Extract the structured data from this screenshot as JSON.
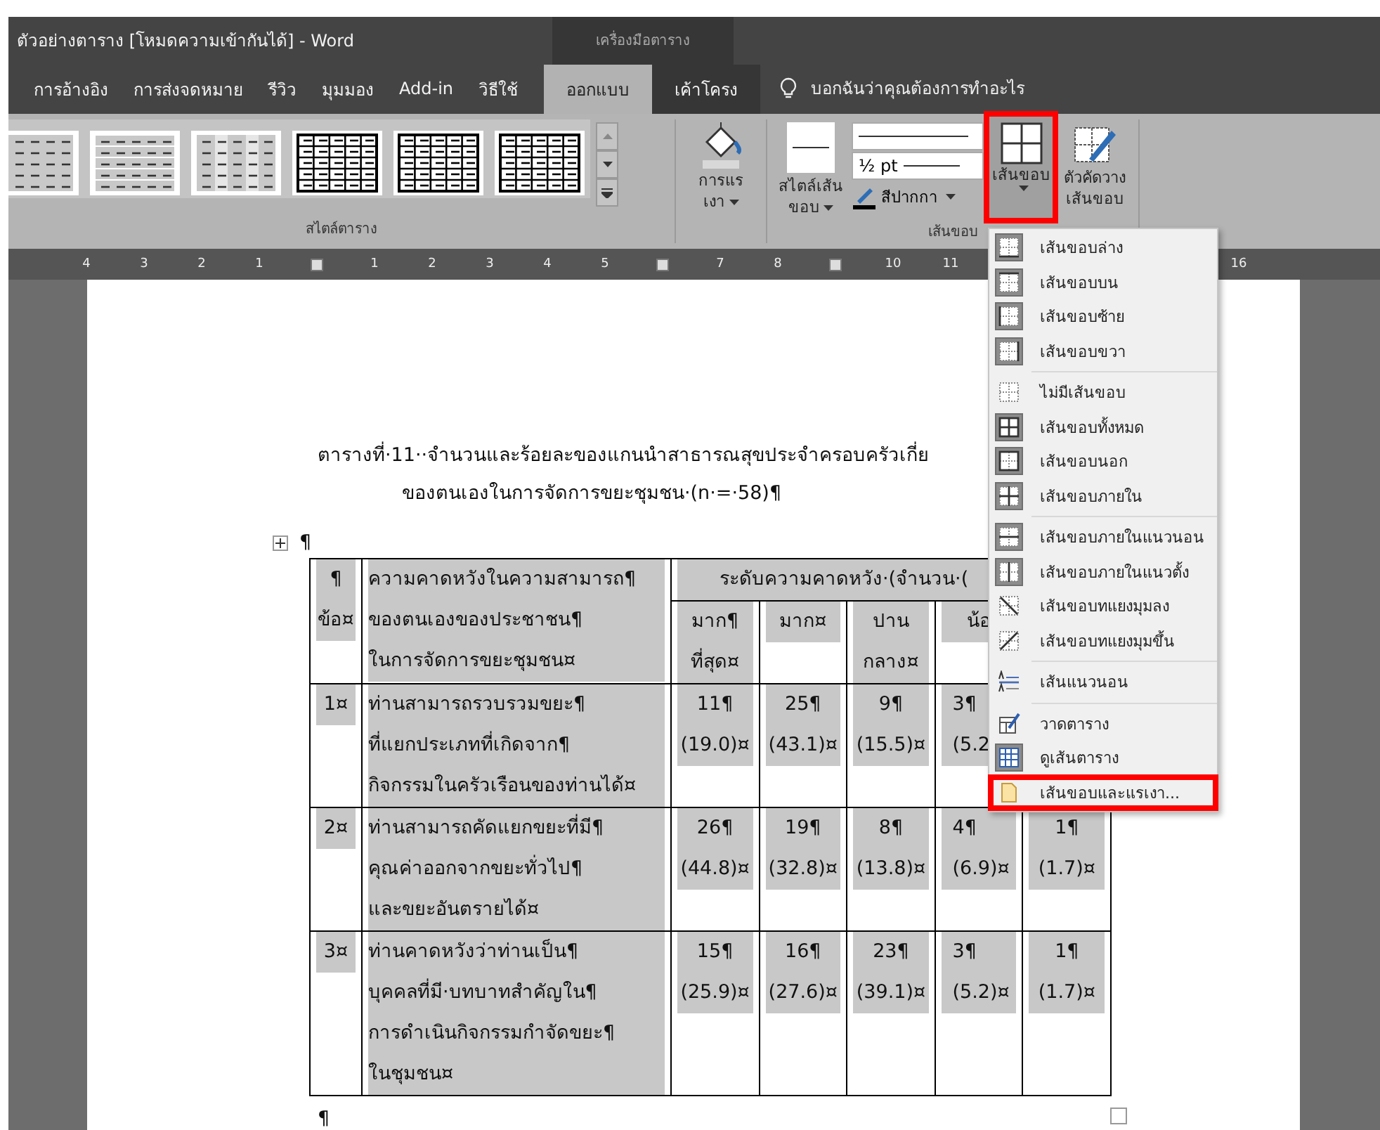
{
  "window": {
    "title": "ตัวอย่างตาราง  [โหมดความเข้ากันได้]  -  Word",
    "context_label": "เครื่องมือตาราง"
  },
  "tabs": [
    {
      "label": "การอ้างอิง",
      "selected": false,
      "contextual": false
    },
    {
      "label": "การส่งจดหมาย",
      "selected": false,
      "contextual": false
    },
    {
      "label": "รีวิว",
      "selected": false,
      "contextual": false
    },
    {
      "label": "มุมมอง",
      "selected": false,
      "contextual": false
    },
    {
      "label": "Add-in",
      "selected": false,
      "contextual": false
    },
    {
      "label": "วิธีใช้",
      "selected": false,
      "contextual": false
    },
    {
      "label": "ออกแบบ",
      "selected": true,
      "contextual": true
    },
    {
      "label": "เค้าโครง",
      "selected": false,
      "contextual": true
    }
  ],
  "tell_me": {
    "placeholder": "บอกฉันว่าคุณต้องการทำอะไร"
  },
  "ribbon": {
    "styles_group": {
      "label": "สไตล์ตาราง",
      "thumbnails": [
        {
          "kind": "plain"
        },
        {
          "kind": "banded-rows"
        },
        {
          "kind": "banded-cols"
        },
        {
          "kind": "grid"
        },
        {
          "kind": "grid"
        },
        {
          "kind": "grid"
        }
      ]
    },
    "shading": {
      "label": [
        "การแร",
        "เงา"
      ]
    },
    "borders_group": {
      "label": "เส้นขอบ",
      "border_styles": [
        "สไตล์เส้น",
        "ขอบ"
      ],
      "line_weight": "½ pt",
      "pen_color": "สีปากกา",
      "borders": {
        "label": "เส้นขอบ",
        "annotated": true
      },
      "border_painter": [
        "ตัวคัดวาง",
        "เส้นขอบ"
      ]
    }
  },
  "ruler": [
    {
      "kind": "number",
      "label": "4"
    },
    {
      "kind": "number",
      "label": "3"
    },
    {
      "kind": "number",
      "label": "2"
    },
    {
      "kind": "number",
      "label": "1"
    },
    {
      "kind": "marker"
    },
    {
      "kind": "number",
      "label": "1"
    },
    {
      "kind": "number",
      "label": "2"
    },
    {
      "kind": "number",
      "label": "3"
    },
    {
      "kind": "number",
      "label": "4"
    },
    {
      "kind": "number",
      "label": "5"
    },
    {
      "kind": "marker"
    },
    {
      "kind": "number",
      "label": "7"
    },
    {
      "kind": "number",
      "label": "8"
    },
    {
      "kind": "marker"
    },
    {
      "kind": "number",
      "label": "10"
    },
    {
      "kind": "number",
      "label": "11"
    },
    {
      "kind": "blank"
    },
    {
      "kind": "blank"
    },
    {
      "kind": "blank"
    },
    {
      "kind": "blank"
    },
    {
      "kind": "number",
      "label": "16"
    }
  ],
  "document": {
    "caption": [
      "ตารางที่·11··จำนวนและร้อยละของแกนนำสาธารณสุขประจำครอบครัวเกี่ย",
      "ของตนเองในการจัดการขยะชุมชน·(n·=·58)¶"
    ],
    "mark_before": "¶",
    "mark_after": "¶",
    "table": {
      "header": {
        "no": [
          "¶",
          "ข้อ¤"
        ],
        "question": [
          "ความคาดหวังในความสามารถ¶",
          "ของตนเองของประชาชน¶",
          "ในการจัดการขยะชุมชน¤"
        ],
        "group": "ระดับความคาดหวัง·(จำนวน·(",
        "levels": [
          [
            "มาก¶",
            "ที่สุด¤"
          ],
          [
            "มาก¤"
          ],
          [
            "ปาน",
            "กลาง¤"
          ],
          [
            "น้อ"
          ]
        ]
      },
      "rows": [
        {
          "no": "1¤",
          "question": [
            "ท่านสามารถรวบรวมขยะ¶",
            "ที่แยกประเภทที่เกิดจาก¶",
            "กิจกรรมในครัวเรือนของท่านได้¤"
          ],
          "values": [
            [
              "11¶",
              "(19.0)¤"
            ],
            [
              "25¶",
              "(43.1)¤"
            ],
            [
              "9¶",
              "(15.5)¤"
            ],
            [
              "3¶",
              "(5.2"
            ]
          ]
        },
        {
          "no": "2¤",
          "question": [
            "ท่านสามารถคัดแยกขยะที่มี¶",
            "คุณค่าออกจากขยะทั่วไป¶",
            "และขยะอันตรายได้¤"
          ],
          "values": [
            [
              "26¶",
              "(44.8)¤"
            ],
            [
              "19¶",
              "(32.8)¤"
            ],
            [
              "8¶",
              "(13.8)¤"
            ],
            [
              "4¶",
              "(6.9)¤"
            ],
            [
              "1¶",
              "(1.7)¤"
            ]
          ]
        },
        {
          "no": "3¤",
          "question": [
            "ท่านคาดหวังว่าท่านเป็น¶",
            "บุคคลที่มี·บทบาทสำคัญใน¶",
            "การดำเนินกิจกรรมกำจัดขยะ¶",
            "ในชุมชน¤"
          ],
          "values": [
            [
              "15¶",
              "(25.9)¤"
            ],
            [
              "16¶",
              "(27.6)¤"
            ],
            [
              "23¶",
              "(39.1)¤"
            ],
            [
              "3¶",
              "(5.2)¤"
            ],
            [
              "1¶",
              "(1.7)¤"
            ]
          ]
        }
      ]
    }
  },
  "borders_menu": {
    "sections": [
      [
        {
          "kind": "bottom",
          "label": "เส้นขอบล่าง",
          "checked": true,
          "annotated": false
        },
        {
          "kind": "top",
          "label": "เส้นขอบบน",
          "checked": true,
          "annotated": false
        },
        {
          "kind": "left",
          "label": "เส้นขอบซ้าย",
          "checked": true,
          "annotated": false
        },
        {
          "kind": "right",
          "label": "เส้นขอบขวา",
          "checked": true,
          "annotated": false
        }
      ],
      [
        {
          "kind": "none",
          "label": "ไม่มีเส้นขอบ",
          "checked": false,
          "annotated": false
        },
        {
          "kind": "all",
          "label": "เส้นขอบทั้งหมด",
          "checked": true,
          "annotated": false
        },
        {
          "kind": "outside",
          "label": "เส้นขอบนอก",
          "checked": true,
          "annotated": false
        },
        {
          "kind": "inside",
          "label": "เส้นขอบภายใน",
          "checked": true,
          "annotated": false
        }
      ],
      [
        {
          "kind": "inside-h",
          "label": "เส้นขอบภายในแนวนอน",
          "checked": true,
          "annotated": false
        },
        {
          "kind": "inside-v",
          "label": "เส้นขอบภายในแนวตั้ง",
          "checked": true,
          "annotated": false
        },
        {
          "kind": "diag-down",
          "label": "เส้นขอบทแยงมุมลง",
          "checked": false,
          "annotated": false
        },
        {
          "kind": "diag-up",
          "label": "เส้นขอบทแยงมุมขึ้น",
          "checked": false,
          "annotated": false
        }
      ],
      [
        {
          "kind": "hline",
          "label": "เส้นแนวนอน",
          "checked": false,
          "annotated": false
        }
      ],
      [
        {
          "kind": "draw",
          "label": "วาดตาราง",
          "checked": false,
          "annotated": false
        },
        {
          "kind": "gridlines",
          "label": "ดูเส้นตาราง",
          "checked": true,
          "annotated": false
        },
        {
          "kind": "dialog",
          "label": "เส้นขอบและแรเงา...",
          "checked": false,
          "annotated": true
        }
      ]
    ]
  }
}
